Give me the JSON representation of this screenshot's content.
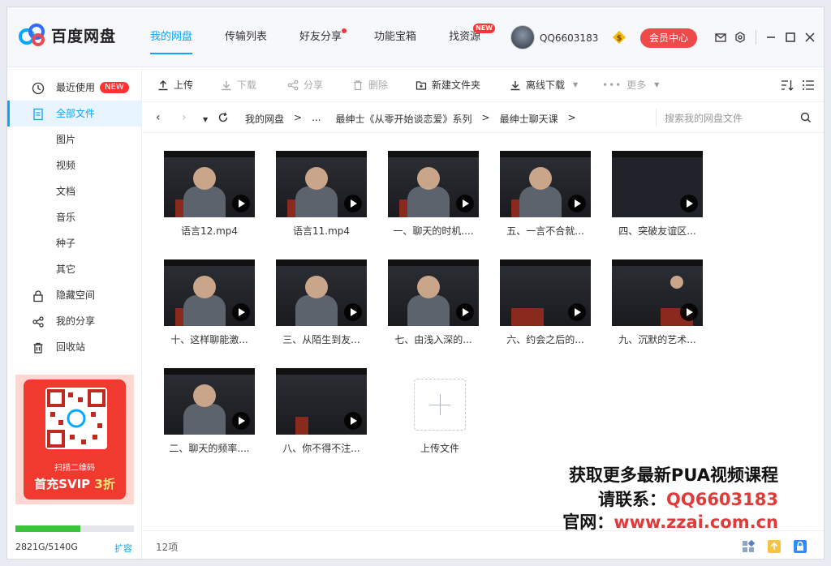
{
  "app": {
    "title": "百度网盘"
  },
  "nav": [
    {
      "label": "我的网盘",
      "active": true
    },
    {
      "label": "传输列表"
    },
    {
      "label": "好友分享",
      "dot": true
    },
    {
      "label": "功能宝箱"
    },
    {
      "label": "找资源",
      "tag": "NEW"
    }
  ],
  "user": {
    "name": "QQ6603183",
    "vip_button": "会员中心"
  },
  "sidebar": {
    "items": [
      {
        "label": "最近使用",
        "icon": "clock-icon",
        "badge": "NEW"
      },
      {
        "label": "全部文件",
        "icon": "document-icon",
        "active": true
      },
      {
        "label": "图片"
      },
      {
        "label": "视频"
      },
      {
        "label": "文档"
      },
      {
        "label": "音乐"
      },
      {
        "label": "种子"
      },
      {
        "label": "其它"
      },
      {
        "label": "隐藏空间",
        "icon": "lock-icon"
      },
      {
        "label": "我的分享",
        "icon": "share-icon"
      },
      {
        "label": "回收站",
        "icon": "trash-icon"
      }
    ],
    "promo": {
      "scan_text": "扫描二维码",
      "offer_prefix": "首充SVIP ",
      "offer_highlight": "3折"
    },
    "storage": {
      "text": "2821G/5140G",
      "used_fraction": 0.549,
      "expand": "扩容"
    }
  },
  "toolbar": {
    "upload": "上传",
    "download": "下载",
    "share": "分享",
    "delete": "删除",
    "new_folder": "新建文件夹",
    "offline_download": "离线下载",
    "more": "更多"
  },
  "breadcrumb": {
    "items": [
      "我的网盘",
      ">",
      "...",
      "最绅士《从零开始谈恋爱》系列",
      ">",
      "最绅士聊天课",
      ">"
    ],
    "search_placeholder": "搜索我的网盘文件"
  },
  "files": [
    {
      "name": "语言12.mp4"
    },
    {
      "name": "语言11.mp4"
    },
    {
      "name": "一、聊天的时机...."
    },
    {
      "name": "五、一言不合就..."
    },
    {
      "name": "四、突破友谊区..."
    },
    {
      "name": "十、这样聊能激..."
    },
    {
      "name": "三、从陌生到友..."
    },
    {
      "name": "七、由浅入深的..."
    },
    {
      "name": "六、约会之后的..."
    },
    {
      "name": "九、沉默的艺术..."
    },
    {
      "name": "二、聊天的频率...."
    },
    {
      "name": "八、你不得不注..."
    }
  ],
  "upload_label": "上传文件",
  "watermark": {
    "line1": "获取更多最新PUA视频课程",
    "line2_prefix": "请联系：",
    "line2_value": "QQ6603183",
    "line3_prefix": "官网：",
    "line3_value": "www.zzai.com.cn"
  },
  "status": {
    "count": "12项"
  },
  "colors": {
    "accent": "#06a7ff",
    "red": "#ef4a4a",
    "storage": "#3bc43b"
  }
}
